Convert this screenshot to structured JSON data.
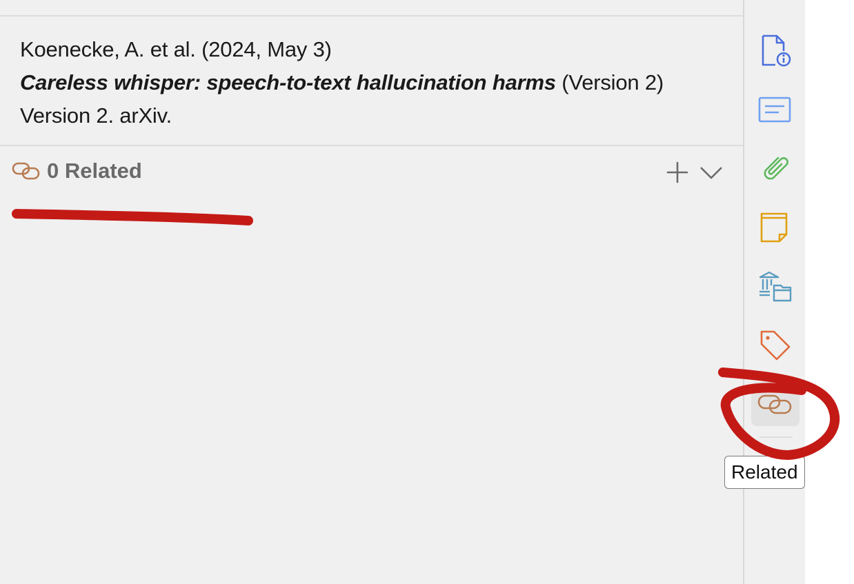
{
  "item_pane": {
    "citation": {
      "authors_date": "Koenecke, A. et al. (2024, May 3)",
      "title": "Careless whisper: speech-to-text hallucination harms",
      "version_suffix": " (Version 2)",
      "publisher_line": "Version 2. arXiv."
    },
    "related_section": {
      "icon": "related-link-icon",
      "label": "0 Related",
      "add_icon": "plus-icon",
      "toggle_icon": "chevron-down-icon"
    }
  },
  "sidenav": {
    "items": [
      {
        "name": "info",
        "icon": "document-info-icon",
        "color": "#4a6fdc"
      },
      {
        "name": "abstract",
        "icon": "abstract-icon",
        "color": "#6fa0f0"
      },
      {
        "name": "attachments",
        "icon": "paperclip-icon",
        "color": "#5cb85c"
      },
      {
        "name": "notes",
        "icon": "note-icon",
        "color": "#e0a010"
      },
      {
        "name": "libraries-collections",
        "icon": "library-collection-icon",
        "color": "#5a9bc0"
      },
      {
        "name": "tags",
        "icon": "tag-icon",
        "color": "#e06b3a"
      },
      {
        "name": "related",
        "icon": "related-link-icon",
        "color": "#b87c52",
        "active": true
      }
    ],
    "tooltip": "Related"
  },
  "annotation": {
    "color": "#c41a16"
  }
}
